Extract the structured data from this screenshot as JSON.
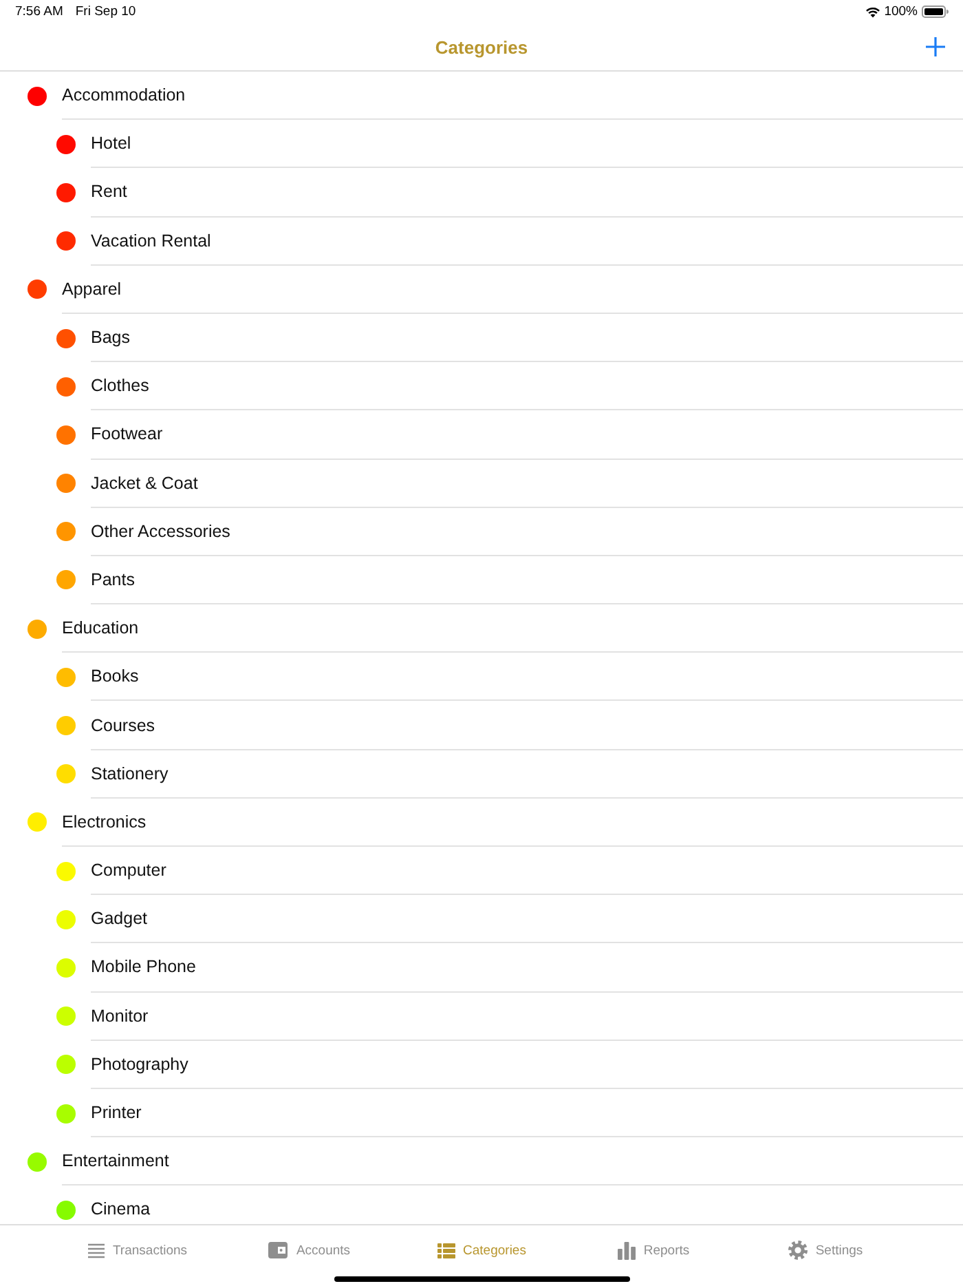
{
  "status_bar": {
    "time": "7:56 AM",
    "date": "Fri Sep 10",
    "battery": "100%"
  },
  "nav_bar": {
    "title": "Categories"
  },
  "categories": [
    {
      "name": "Accommodation",
      "color": "#fe0000",
      "children": [
        {
          "name": "Hotel",
          "color": "#ff0a00"
        },
        {
          "name": "Rent",
          "color": "#ff1a00"
        },
        {
          "name": "Vacation Rental",
          "color": "#ff2b00"
        }
      ]
    },
    {
      "name": "Apparel",
      "color": "#ff3d00",
      "children": [
        {
          "name": "Bags",
          "color": "#ff5000"
        },
        {
          "name": "Clothes",
          "color": "#ff6000"
        },
        {
          "name": "Footwear",
          "color": "#ff7200"
        },
        {
          "name": "Jacket & Coat",
          "color": "#ff8300"
        },
        {
          "name": "Other Accessories",
          "color": "#ff9500"
        },
        {
          "name": "Pants",
          "color": "#ffa600"
        }
      ]
    },
    {
      "name": "Education",
      "color": "#fdab00",
      "children": [
        {
          "name": "Books",
          "color": "#ffbc00"
        },
        {
          "name": "Courses",
          "color": "#ffcc00"
        },
        {
          "name": "Stationery",
          "color": "#ffdd00"
        }
      ]
    },
    {
      "name": "Electronics",
      "color": "#ffee00",
      "children": [
        {
          "name": "Computer",
          "color": "#fbfa00"
        },
        {
          "name": "Gadget",
          "color": "#ecfd00"
        },
        {
          "name": "Mobile Phone",
          "color": "#dcfd00"
        },
        {
          "name": "Monitor",
          "color": "#ccff00"
        },
        {
          "name": "Photography",
          "color": "#bbff00"
        },
        {
          "name": "Printer",
          "color": "#a8fd00"
        }
      ]
    },
    {
      "name": "Entertainment",
      "color": "#97fb00",
      "children": [
        {
          "name": "Cinema",
          "color": "#86fb00"
        }
      ]
    }
  ],
  "tab_bar": {
    "tabs": [
      {
        "label": "Transactions",
        "selected": false
      },
      {
        "label": "Accounts",
        "selected": false
      },
      {
        "label": "Categories",
        "selected": true
      },
      {
        "label": "Reports",
        "selected": false
      },
      {
        "label": "Settings",
        "selected": false
      }
    ]
  }
}
